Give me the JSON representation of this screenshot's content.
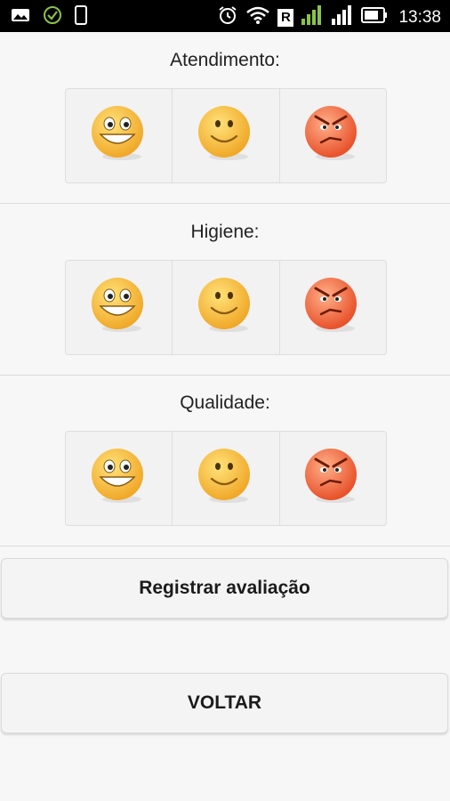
{
  "status_bar": {
    "time": "13:38",
    "left_icons": [
      "gallery-icon",
      "check-circle-icon",
      "phone-icon"
    ],
    "right_icons": [
      "alarm-icon",
      "wifi-icon",
      "roaming-icon",
      "signal-icon",
      "signal-icon-2",
      "battery-icon"
    ],
    "roaming_label": "R",
    "check_color": "#8bc34a"
  },
  "sections": [
    {
      "title": "Atendimento:"
    },
    {
      "title": "Higiene:"
    },
    {
      "title": "Qualidade:"
    }
  ],
  "rating_options": [
    {
      "icon": "grinning-face-icon",
      "meaning": "happy"
    },
    {
      "icon": "smiling-face-icon",
      "meaning": "neutral"
    },
    {
      "icon": "angry-face-icon",
      "meaning": "angry"
    }
  ],
  "buttons": {
    "submit_label": "Registrar avaliação",
    "back_label": "VOLTAR"
  },
  "colors": {
    "background": "#f7f7f7",
    "face_yellow": "#f6c33a",
    "face_angry": "#ee6a3d"
  }
}
